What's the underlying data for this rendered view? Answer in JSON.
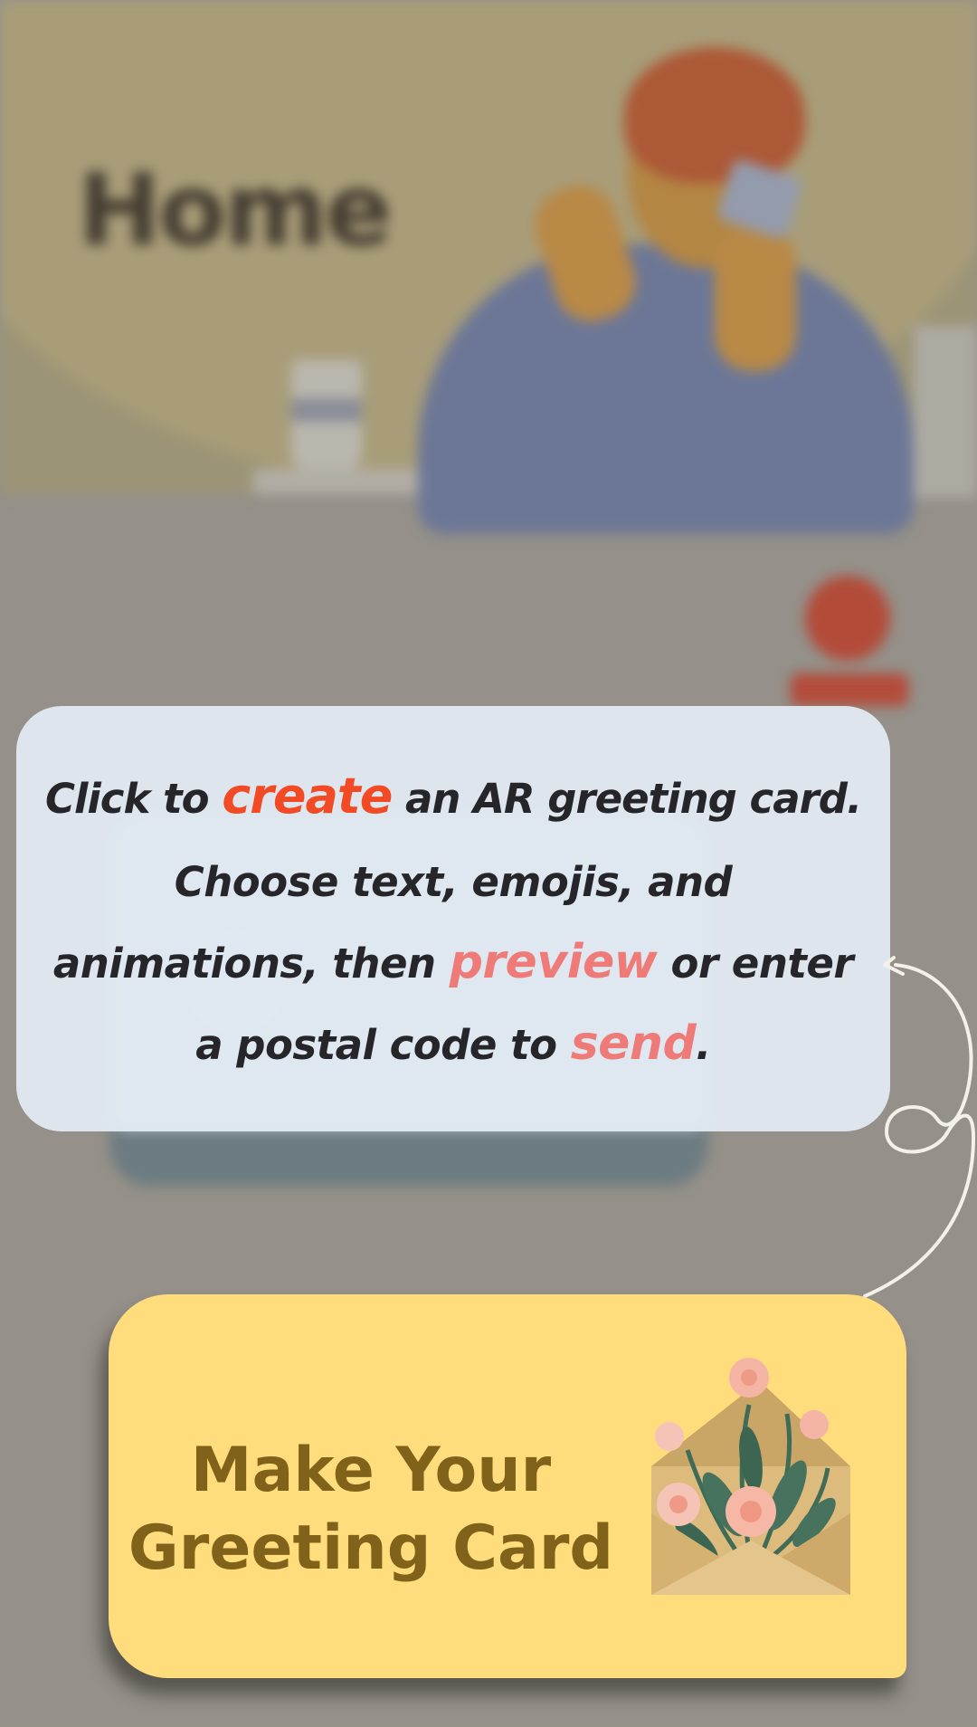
{
  "background": {
    "page_title": "Home",
    "help_label": "?"
  },
  "tooltip": {
    "line1": {
      "prefix": "Click to ",
      "keyword": "create",
      "suffix": " an AR greeting card."
    },
    "line2": {
      "part1": "Choose text, emojis, and animations, then ",
      "keyword1": "preview",
      "part2": " or enter a postal code to ",
      "keyword2": "send",
      "part3": "."
    }
  },
  "cta": {
    "title_line1": "Make Your",
    "title_line2": "Greeting Card",
    "icon": "envelope-flowers-icon"
  },
  "colors": {
    "create": "#f14a25",
    "preview_send": "#ef7b78",
    "cta_bg": "#ffdc7c",
    "cta_text": "#80621a",
    "tooltip_bg": "#e2eaf2"
  }
}
